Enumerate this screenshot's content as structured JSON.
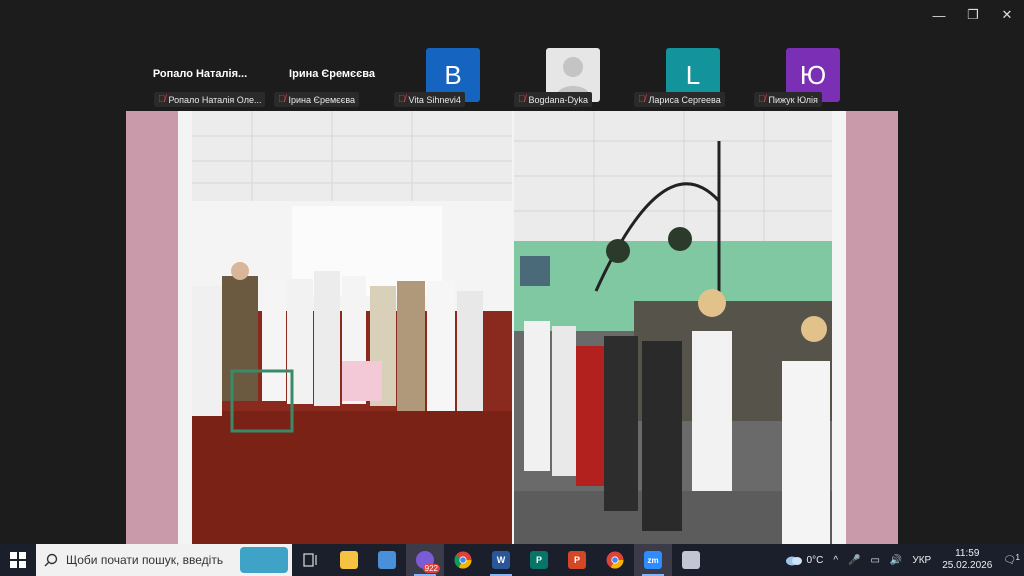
{
  "window": {
    "minimize": "—",
    "restore": "❐",
    "close": "✕"
  },
  "participants": [
    {
      "display": "Ропало  Наталія...",
      "label": "Ропало Наталія Оле...",
      "avatar_letter": "",
      "avatar_color": ""
    },
    {
      "display": "Ірина Єремєєва",
      "label": "Ірина Єремєєва",
      "avatar_letter": "",
      "avatar_color": ""
    },
    {
      "display": "",
      "label": "Vita Sihnevi4",
      "avatar_letter": "B",
      "avatar_color": "#1565c0"
    },
    {
      "display": "",
      "label": "Bogdana-Dyka",
      "avatar_letter": "",
      "avatar_color": "#e6e6e6"
    },
    {
      "display": "",
      "label": "Лариса Сергеева",
      "avatar_letter": "L",
      "avatar_color": "#13939b"
    },
    {
      "display": "",
      "label": "Пижук Юлія",
      "avatar_letter": "Ю",
      "avatar_color": "#7b2fb5"
    }
  ],
  "taskbar": {
    "search_placeholder": "Щоби почати пошук, введіть",
    "viber_badge": "922",
    "word": "W",
    "publisher": "P",
    "powerpoint": "P",
    "zoom": "zm"
  },
  "tray": {
    "temperature": "0°C",
    "language": "УКР",
    "time": "11:59",
    "date": "25.02.2026",
    "notifications": "1"
  },
  "colors": {
    "share_border": "#c89aaa",
    "taskbar_bg": "#1a1f2b",
    "mute_red": "#e23b3b"
  }
}
